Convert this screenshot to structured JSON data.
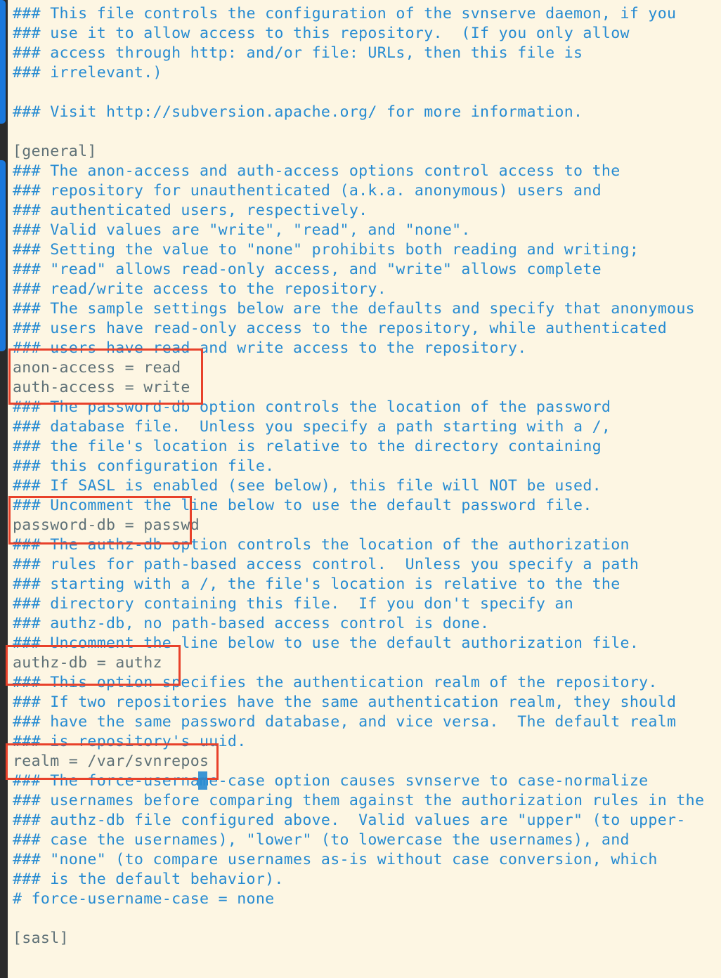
{
  "colors": {
    "background": "#fdf6e3",
    "comment": "#268bd2",
    "text": "#5f7177",
    "highlight_box": "#e8412a",
    "gutter_marker": "#1a78dc"
  },
  "lines": [
    {
      "t": "### This file controls the configuration of the svnserve daemon, if you",
      "k": "c"
    },
    {
      "t": "### use it to allow access to this repository.  (If you only allow",
      "k": "c"
    },
    {
      "t": "### access through http: and/or file: URLs, then this file is",
      "k": "c"
    },
    {
      "t": "### irrelevant.)",
      "k": "c"
    },
    {
      "t": "",
      "k": "n"
    },
    {
      "t": "### Visit http://subversion.apache.org/ for more information.",
      "k": "c"
    },
    {
      "t": "",
      "k": "n"
    },
    {
      "t": "[general]",
      "k": "n"
    },
    {
      "t": "### The anon-access and auth-access options control access to the",
      "k": "c"
    },
    {
      "t": "### repository for unauthenticated (a.k.a. anonymous) users and",
      "k": "c"
    },
    {
      "t": "### authenticated users, respectively.",
      "k": "c"
    },
    {
      "t": "### Valid values are \"write\", \"read\", and \"none\".",
      "k": "c"
    },
    {
      "t": "### Setting the value to \"none\" prohibits both reading and writing;",
      "k": "c"
    },
    {
      "t": "### \"read\" allows read-only access, and \"write\" allows complete",
      "k": "c"
    },
    {
      "t": "### read/write access to the repository.",
      "k": "c"
    },
    {
      "t": "### The sample settings below are the defaults and specify that anonymous",
      "k": "c"
    },
    {
      "t": "### users have read-only access to the repository, while authenticated",
      "k": "c"
    },
    {
      "t": "### users have read and write access to the repository.",
      "k": "c"
    },
    {
      "t": "anon-access = read",
      "k": "n"
    },
    {
      "t": "auth-access = write",
      "k": "n"
    },
    {
      "t": "### The password-db option controls the location of the password",
      "k": "c"
    },
    {
      "t": "### database file.  Unless you specify a path starting with a /,",
      "k": "c"
    },
    {
      "t": "### the file's location is relative to the directory containing",
      "k": "c"
    },
    {
      "t": "### this configuration file.",
      "k": "c"
    },
    {
      "t": "### If SASL is enabled (see below), this file will NOT be used.",
      "k": "c"
    },
    {
      "t": "### Uncomment the line below to use the default password file.",
      "k": "c"
    },
    {
      "t": "password-db = passwd",
      "k": "n"
    },
    {
      "t": "### The authz-db option controls the location of the authorization",
      "k": "c"
    },
    {
      "t": "### rules for path-based access control.  Unless you specify a path",
      "k": "c"
    },
    {
      "t": "### starting with a /, the file's location is relative to the the",
      "k": "c"
    },
    {
      "t": "### directory containing this file.  If you don't specify an",
      "k": "c"
    },
    {
      "t": "### authz-db, no path-based access control is done.",
      "k": "c"
    },
    {
      "t": "### Uncomment the line below to use the default authorization file.",
      "k": "c"
    },
    {
      "t": "authz-db = authz",
      "k": "n"
    },
    {
      "t": "### This option specifies the authentication realm of the repository.",
      "k": "c"
    },
    {
      "t": "### If two repositories have the same authentication realm, they should",
      "k": "c"
    },
    {
      "t": "### have the same password database, and vice versa.  The default realm",
      "k": "c"
    },
    {
      "t": "### is repository's uuid.",
      "k": "c"
    },
    {
      "t": "realm = /var/svnrepos",
      "k": "n"
    },
    {
      "t": "### The force-username-case option causes svnserve to case-normalize",
      "k": "c"
    },
    {
      "t": "### usernames before comparing them against the authorization rules in the",
      "k": "c"
    },
    {
      "t": "### authz-db file configured above.  Valid values are \"upper\" (to upper-",
      "k": "c"
    },
    {
      "t": "### case the usernames), \"lower\" (to lowercase the usernames), and",
      "k": "c"
    },
    {
      "t": "### \"none\" (to compare usernames as-is without case conversion, which",
      "k": "c"
    },
    {
      "t": "### is the default behavior).",
      "k": "c"
    },
    {
      "t": "# force-username-case = none",
      "k": "c"
    },
    {
      "t": "",
      "k": "n"
    },
    {
      "t": "[sasl]",
      "k": "n"
    }
  ]
}
